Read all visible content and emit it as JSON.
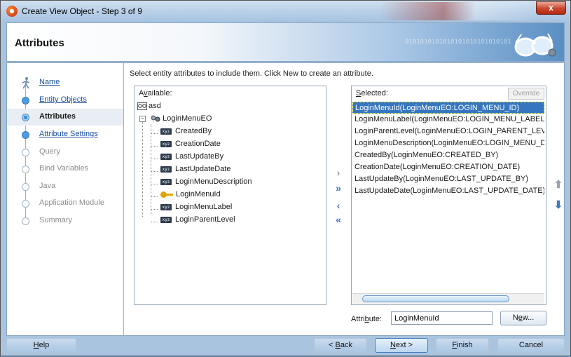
{
  "window": {
    "title": "Create View Object - Step 3 of 9",
    "close_label": "x"
  },
  "header": {
    "title": "Attributes",
    "binary_text": "0101010101010101010101010101"
  },
  "nav": {
    "items": [
      {
        "label": "Name",
        "state": "done"
      },
      {
        "label": "Entity Objects",
        "state": "done"
      },
      {
        "label": "Attributes",
        "state": "current"
      },
      {
        "label": "Attribute Settings",
        "state": "done"
      },
      {
        "label": "Query",
        "state": "future"
      },
      {
        "label": "Bind Variables",
        "state": "future"
      },
      {
        "label": "Java",
        "state": "future"
      },
      {
        "label": "Application Module",
        "state": "future"
      },
      {
        "label": "Summary",
        "state": "future"
      }
    ]
  },
  "main": {
    "instruction": "Select entity attributes to include them.  Click New to create an attribute.",
    "available": {
      "header_pre": "A",
      "header_u": "v",
      "header_post": "ailable:",
      "root": "asd",
      "entity": "LoginMenuEO",
      "attributes": [
        {
          "name": "CreatedBy",
          "key": false
        },
        {
          "name": "CreationDate",
          "key": false
        },
        {
          "name": "LastUpdateBy",
          "key": false
        },
        {
          "name": "LastUpdateDate",
          "key": false
        },
        {
          "name": "LoginMenuDescription",
          "key": false
        },
        {
          "name": "LoginMenuId",
          "key": true
        },
        {
          "name": "LoginMenuLabel",
          "key": false
        },
        {
          "name": "LoginParentLevel",
          "key": false
        }
      ]
    },
    "move": {
      "add": "›",
      "add_all": "»",
      "remove": "‹",
      "remove_all": "«"
    },
    "selected": {
      "header_u": "S",
      "header_post": "elected:",
      "override_label": "Override",
      "items": [
        "LoginMenuId(LoginMenuEO:LOGIN_MENU_ID)",
        "LoginMenuLabel(LoginMenuEO:LOGIN_MENU_LABEL)",
        "LoginParentLevel(LoginMenuEO:LOGIN_PARENT_LEVEL)",
        "LoginMenuDescription(LoginMenuEO:LOGIN_MENU_DESC",
        "CreatedBy(LoginMenuEO:CREATED_BY)",
        "CreationDate(LoginMenuEO:CREATION_DATE)",
        "LastUpdateBy(LoginMenuEO:LAST_UPDATE_BY)",
        "LastUpdateDate(LoginMenuEO:LAST_UPDATE_DATE)"
      ],
      "selected_index": 0
    },
    "order": {
      "up": "⬆",
      "down": "⬇"
    },
    "attribute": {
      "label_pre": "Attri",
      "label_u": "b",
      "label_post": "ute:",
      "value": "LoginMenuId",
      "new_pre": "N",
      "new_u": "e",
      "new_post": "w..."
    }
  },
  "footer": {
    "help_u": "H",
    "help_post": "elp",
    "back_pre": "< ",
    "back_u": "B",
    "back_post": "ack",
    "next_u": "N",
    "next_post": "ext >",
    "finish_u": "F",
    "finish_post": "inish",
    "cancel": "Cancel"
  },
  "colors": {
    "selection": "#3676c0",
    "link": "#1b4fa2",
    "arrow": "#3c78c2"
  }
}
